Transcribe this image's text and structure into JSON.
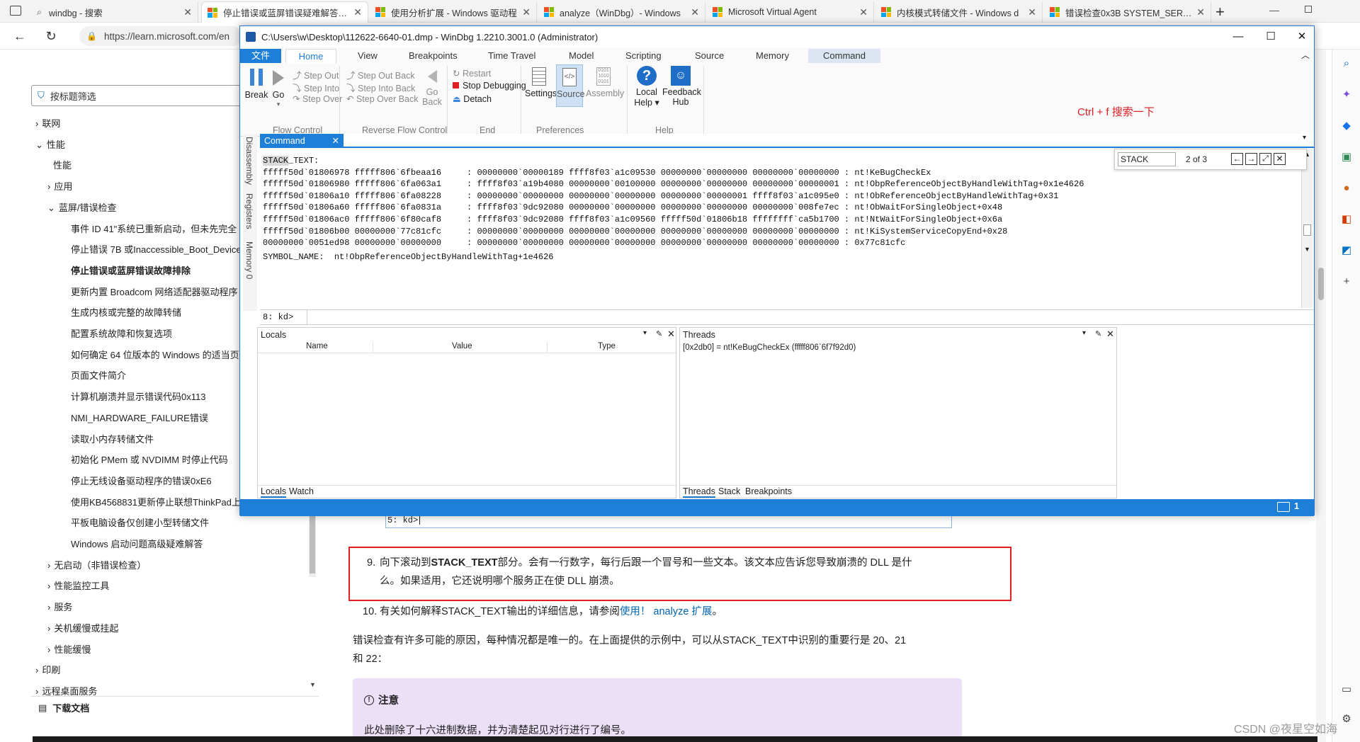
{
  "browser": {
    "tabs": [
      {
        "title": "windbg - 搜索",
        "icon": "search-icon"
      },
      {
        "title": "停止错误或蓝屏错误疑难解答 - V",
        "icon": "microsoft-logo-icon"
      },
      {
        "title": "使用分析扩展 - Windows 驱动程",
        "icon": "microsoft-logo-icon"
      },
      {
        "title": "analyze（WinDbg）- Windows",
        "icon": "microsoft-logo-icon"
      },
      {
        "title": "Microsoft Virtual Agent",
        "icon": "microsoft-logo-icon"
      },
      {
        "title": "内核模式转储文件 - Windows d",
        "icon": "microsoft-logo-icon"
      },
      {
        "title": "错误检查0x3B SYSTEM_SERVICE",
        "icon": "microsoft-logo-icon"
      }
    ],
    "url": "https://learn.microsoft.com/en"
  },
  "doc_nav": {
    "filter_placeholder": "按标题筛选",
    "items": [
      {
        "label": "联网",
        "prefix": "›"
      },
      {
        "label": "性能",
        "prefix": "⌄"
      },
      {
        "label": "性能",
        "prefix": ""
      },
      {
        "label": "应用",
        "prefix": "›"
      },
      {
        "label": "蓝屏/错误检查",
        "prefix": "⌄"
      },
      {
        "label": "事件 ID 41\"系统已重新启动，但未先完全",
        "prefix": ""
      },
      {
        "label": "停止错误 7B 或Inaccessible_Boot_Device",
        "prefix": ""
      },
      {
        "label": "停止错误或蓝屏错误故障排除",
        "prefix": ""
      },
      {
        "label": "更新内置 Broadcom 网络适配器驱动程序",
        "prefix": ""
      },
      {
        "label": "生成内核或完整的故障转储",
        "prefix": ""
      },
      {
        "label": "配置系统故障和恢复选项",
        "prefix": ""
      },
      {
        "label": "如何确定 64 位版本的 Windows 的适当页",
        "prefix": ""
      },
      {
        "label": "页面文件简介",
        "prefix": ""
      },
      {
        "label": "计算机崩溃并显示错误代码0x113",
        "prefix": ""
      },
      {
        "label": "NMI_HARDWARE_FAILURE错误",
        "prefix": ""
      },
      {
        "label": "读取小内存转储文件",
        "prefix": ""
      },
      {
        "label": "初始化 PMem 或 NVDIMM 时停止代码",
        "prefix": ""
      },
      {
        "label": "停止无线设备驱动程序的错误0xE6",
        "prefix": ""
      },
      {
        "label": "使用KB4568831更新停止联想ThinkPad上",
        "prefix": ""
      },
      {
        "label": "平板电脑设备仅创建小型转储文件",
        "prefix": ""
      },
      {
        "label": "Windows 启动问题高级疑难解答",
        "prefix": ""
      },
      {
        "label": "无启动（非错误检查）",
        "prefix": "›"
      },
      {
        "label": "性能监控工具",
        "prefix": "›"
      },
      {
        "label": "服务",
        "prefix": "›"
      },
      {
        "label": "关机缓慢或挂起",
        "prefix": "›"
      },
      {
        "label": "性能缓慢",
        "prefix": "›"
      },
      {
        "label": "印刷",
        "prefix": "›"
      },
      {
        "label": "远程桌面服务",
        "prefix": "›"
      }
    ],
    "download": "下载文档"
  },
  "article": {
    "prev_cmd": "5: kd>",
    "step9_num": "9.",
    "step9_a": "向下滚动到",
    "step9_b": "STACK_TEXT",
    "step9_c": "部分。会有一行数字，每行后跟一个冒号和一些文本。该文本应告诉您导致崩溃的 DLL 是什",
    "step9_d": "么。如果适用，它还说明哪个服务正在使 DLL 崩溃。",
    "step10_num": "10.",
    "step10_a": "有关如何解释STACK_TEXT输出的详细信息，请参阅",
    "step10_link": "使用！ analyze 扩展",
    "step10_end": "。",
    "para1": "错误检查有许多可能的原因，每种情况都是唯一的。在上面提供的示例中，可以从STACK_TEXT中识别的重要行是 20、21",
    "para2": "和 22：",
    "note_title": "注意",
    "note_text": "此处删除了十六进制数据，并为清楚起见对行进行了编号。"
  },
  "windbg": {
    "title": "C:\\Users\\w\\Desktop\\112622-6640-01.dmp - WinDbg 1.2210.3001.0 (Administrator)",
    "ribbon_tabs": [
      "文件",
      "Home",
      "View",
      "Breakpoints",
      "Time Travel",
      "Model",
      "Scripting",
      "Source",
      "Memory",
      "Command"
    ],
    "flow": {
      "break": "Break",
      "go": "Go",
      "step_out": "Step Out",
      "step_into": "Step Into",
      "step_over": "Step Over",
      "group": "Flow Control"
    },
    "reverse": {
      "step_out_back": "Step Out Back",
      "step_into_back": "Step Into Back",
      "step_over_back": "Step Over Back",
      "go_back_1": "Go",
      "go_back_2": "Back",
      "group": "Reverse Flow Control"
    },
    "end": {
      "restart": "Restart",
      "stop": "Stop Debugging",
      "detach": "Detach",
      "group": "End"
    },
    "prefs": {
      "settings": "Settings",
      "source": "Source",
      "assembly": "Assembly",
      "group": "Preferences"
    },
    "help": {
      "local_1": "Local",
      "local_2": "Help ▾",
      "feedback_1": "Feedback",
      "feedback_2": "Hub",
      "group": "Help"
    },
    "annotation": "Ctrl + f 搜索一下",
    "side_tabs": [
      "Disassembly",
      "Registers",
      "Memory 0"
    ],
    "command_tab": "Command",
    "find": {
      "value": "STACK",
      "count": "2 of 3"
    },
    "stack_text": "STACK_TEXT:  \nfffff50d`01806978 fffff806`6fbeaa16     : 00000000`00000189 ffff8f03`a1c09530 00000000`00000000 00000000`00000000 : nt!KeBugCheckEx\nfffff50d`01806980 fffff806`6fa063a1     : ffff8f03`a19b4080 00000000`00100000 00000000`00000000 00000000`00000001 : nt!ObpReferenceObjectByHandleWithTag+0x1e4626\nfffff50d`01806a10 fffff806`6fa08228     : 00000000`00000000 00000000`00000000 00000000`00000001 ffff8f03`a1c095e0 : nt!ObReferenceObjectByHandleWithTag+0x31\nfffff50d`01806a60 fffff806`6fa0831a     : ffff8f03`9dc92080 00000000`00000000 00000000`00000000 00000000`008fe7ec : nt!ObWaitForSingleObject+0x48\nfffff50d`01806ac0 fffff806`6f80caf8     : ffff8f03`9dc92080 ffff8f03`a1c09560 fffff50d`01806b18 ffffffff`ca5b1700 : nt!NtWaitForSingleObject+0x6a\nfffff50d`01806b00 00000000`77c81cfc     : 00000000`00000000 00000000`00000000 00000000`00000000 00000000`00000000 : nt!KiSystemServiceCopyEnd+0x28\n00000000`0051ed98 00000000`00000000     : 00000000`00000000 00000000`00000000 00000000`00000000 00000000`00000000 : 0x77c81cfc",
    "symbol_line": "SYMBOL_NAME:  nt!ObpReferenceObjectByHandleWithTag+1e4626",
    "prompt": "8: kd>",
    "locals": {
      "title": "Locals",
      "cols": [
        "Name",
        "Value",
        "Type"
      ],
      "tabs": [
        "Locals",
        "Watch"
      ]
    },
    "threads": {
      "title": "Threads",
      "row": "[0x2db0] = nt!KeBugCheckEx (fffff806`6f7f92d0)",
      "tabs": [
        "Threads",
        "Stack",
        "Breakpoints"
      ]
    },
    "status_count": "1"
  },
  "watermark": "CSDN @夜星空如海"
}
